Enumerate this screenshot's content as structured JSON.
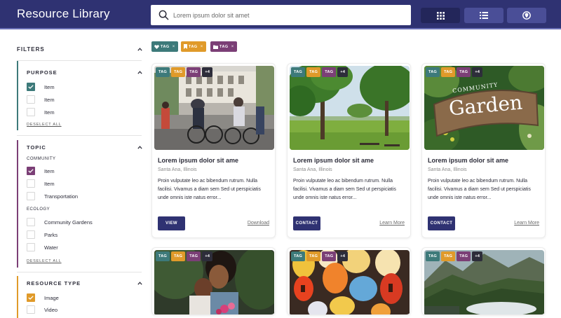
{
  "header": {
    "title": "Resource Library",
    "search_placeholder": "Lorem ipsum dolor sit amet"
  },
  "colors": {
    "header_bg": "#2f3272",
    "teal": "#3d7a7a",
    "orange": "#e09a2a",
    "purple": "#7b3f76",
    "dark": "#2d2d3a"
  },
  "view_buttons": [
    {
      "icon": "grid-icon",
      "active": true
    },
    {
      "icon": "list-icon",
      "active": false
    },
    {
      "icon": "map-pin-icon",
      "active": false
    }
  ],
  "active_tags": [
    {
      "label": "TAG",
      "icon": "heart-icon",
      "color": "teal"
    },
    {
      "label": "TAG",
      "icon": "bookmark-icon",
      "color": "orange"
    },
    {
      "label": "TAG",
      "icon": "folder-icon",
      "color": "purple"
    }
  ],
  "sidebar": {
    "filters_title": "FILTERS",
    "purpose": {
      "title": "PURPOSE",
      "items": [
        {
          "label": "Item",
          "checked": true
        },
        {
          "label": "Item",
          "checked": false
        },
        {
          "label": "Item",
          "checked": false
        }
      ],
      "deselect": "DESELECT ALL"
    },
    "topic": {
      "title": "TOPIC",
      "community_label": "COMMUNITY",
      "community_items": [
        {
          "label": "Item",
          "checked": true
        },
        {
          "label": "Item",
          "checked": false
        },
        {
          "label": "Transportation",
          "checked": false
        }
      ],
      "ecology_label": "ECOLOGY",
      "ecology_items": [
        {
          "label": "Community Gardens",
          "checked": false
        },
        {
          "label": "Parks",
          "checked": false
        },
        {
          "label": "Water",
          "checked": false
        }
      ],
      "deselect": "DESELECT ALL"
    },
    "resource_type": {
      "title": "RESOURCE TYPE",
      "items": [
        {
          "label": "Image",
          "checked": true
        },
        {
          "label": "Video",
          "checked": false
        }
      ]
    }
  },
  "cards": [
    {
      "tags": [
        "TAG",
        "TAG",
        "TAG",
        "+4"
      ],
      "title": "Lorem ipsum dolor sit ame",
      "location": "Santa Ana, Illinois",
      "description": "Proin vulputate leo ac bibendum rutrum. Nulla facilisi. Vivamus a diam sem Sed ut perspiciatis unde omnis iste natus error...",
      "button": "VIEW",
      "link": "Download",
      "image": "city-cyclists"
    },
    {
      "tags": [
        "TAG",
        "TAG",
        "TAG",
        "+4"
      ],
      "title": "Lorem ipsum dolor sit ame",
      "location": "Santa Ana, Illinois",
      "description": "Proin vulputate leo ac bibendum rutrum. Nulla facilisi. Vivamus a diam sem Sed ut perspiciatis unde omnis iste natus error...",
      "button": "CONTACT",
      "link": "Learn More",
      "image": "park"
    },
    {
      "tags": [
        "TAG",
        "TAG",
        "TAG",
        "+4"
      ],
      "title": "Lorem ipsum dolor sit ame",
      "location": "Santa Ana, Illinois",
      "description": "Proin vulputate leo ac bibendum rutrum. Nulla facilisi. Vivamus a diam sem Sed ut perspiciatis unde omnis iste natus error...",
      "button": "CONTACT",
      "link": "Learn More",
      "image": "community-garden-sign",
      "sign_text_top": "COMMUNITY",
      "sign_text_main": "Garden"
    },
    {
      "tags": [
        "TAG",
        "TAG",
        "TAG",
        "+4"
      ],
      "image": "women-portrait"
    },
    {
      "tags": [
        "TAG",
        "TAG",
        "TAG",
        "+4"
      ],
      "image": "lanterns"
    },
    {
      "tags": [
        "TAG",
        "TAG",
        "TAG",
        "+4"
      ],
      "image": "mountain-lake"
    }
  ]
}
